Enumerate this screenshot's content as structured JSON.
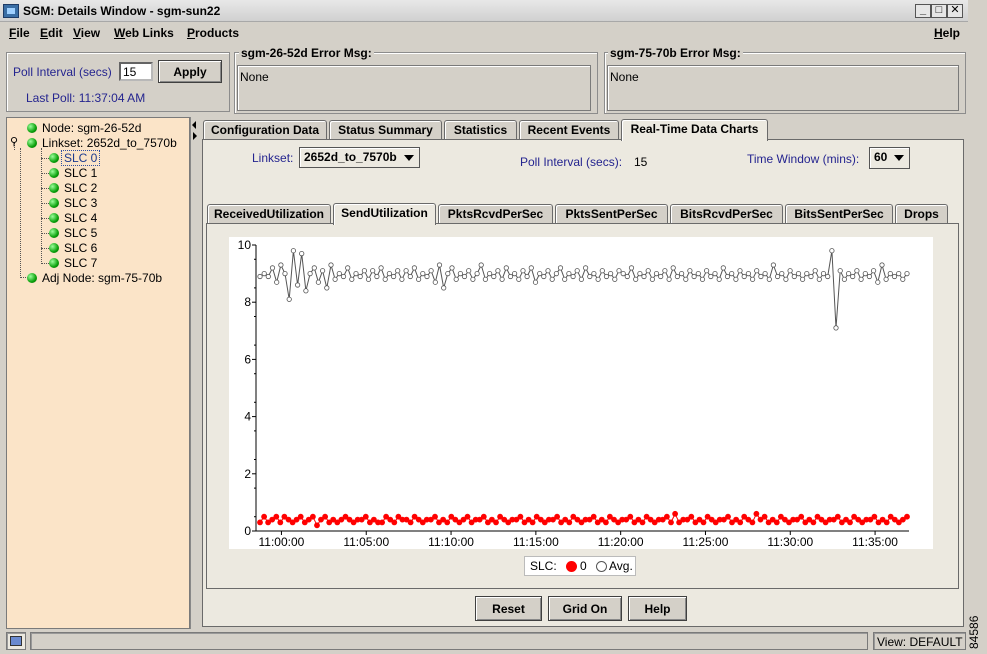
{
  "window": {
    "title": "SGM: Details Window - sgm-sun22",
    "figure_id": "84586"
  },
  "menu": {
    "items": [
      {
        "label": "File",
        "u": "F",
        "rest": "ile"
      },
      {
        "label": "Edit",
        "u": "E",
        "rest": "dit"
      },
      {
        "label": "View",
        "u": "V",
        "rest": "iew"
      },
      {
        "label": "Web Links",
        "u": "W",
        "rest": "eb Links"
      },
      {
        "label": "Products",
        "u": "P",
        "rest": "roducts"
      }
    ],
    "help": {
      "label": "Help",
      "u": "H",
      "rest": "elp"
    }
  },
  "poll": {
    "interval_label": "Poll Interval (secs)",
    "interval_value": "15",
    "apply_label": "Apply",
    "last_poll": "Last Poll:  11:37:04 AM"
  },
  "error_boxes": [
    {
      "title": "sgm-26-52d  Error Msg:",
      "message": "None"
    },
    {
      "title": "sgm-75-70b  Error Msg:",
      "message": "None"
    }
  ],
  "tree": {
    "node": "Node: sgm-26-52d",
    "linkset": "Linkset: 2652d_to_7570b",
    "slcs": [
      "SLC 0",
      "SLC 1",
      "SLC 2",
      "SLC 3",
      "SLC 4",
      "SLC 5",
      "SLC 6",
      "SLC 7"
    ],
    "selected_slc": "SLC 0",
    "adj_node": "Adj Node: sgm-75-70b"
  },
  "top_tabs": {
    "items": [
      "Configuration Data",
      "Status Summary",
      "Statistics",
      "Recent Events",
      "Real-Time Data Charts"
    ],
    "active": "Real-Time Data Charts"
  },
  "controls": {
    "linkset_label": "Linkset:",
    "linkset_value": "2652d_to_7570b",
    "poll_interval_label": "Poll Interval (secs):",
    "poll_interval_value": "15",
    "time_window_label": "Time Window (mins):",
    "time_window_value": "60"
  },
  "chart_tabs": {
    "items": [
      "ReceivedUtilization",
      "SendUtilization",
      "PktsRcvdPerSec",
      "PktsSentPerSec",
      "BitsRcvdPerSec",
      "BitsSentPerSec",
      "Drops"
    ],
    "active": "SendUtilization"
  },
  "chart": {
    "y_ticks": [
      "0",
      "2",
      "4",
      "6",
      "8",
      "10"
    ],
    "x_ticks": [
      "11:00:00",
      "11:05:00",
      "11:10:00",
      "11:15:00",
      "11:20:00",
      "11:25:00",
      "11:30:00",
      "11:35:00"
    ],
    "legend": {
      "prefix": "SLC:",
      "series0": "0",
      "avg": "Avg."
    },
    "colors": {
      "slc0": "#ff0000",
      "avg": "#555555"
    }
  },
  "chart_data": {
    "type": "line",
    "ylim": [
      0,
      10
    ],
    "x_range": [
      "10:58:30",
      "11:37:00"
    ],
    "x_ticks": [
      "11:00:00",
      "11:05:00",
      "11:10:00",
      "11:15:00",
      "11:20:00",
      "11:25:00",
      "11:30:00",
      "11:35:00"
    ],
    "series": [
      {
        "name": "0",
        "color": "#ff0000",
        "values": [
          0.3,
          0.5,
          0.3,
          0.4,
          0.5,
          0.3,
          0.5,
          0.4,
          0.3,
          0.4,
          0.5,
          0.3,
          0.4,
          0.5,
          0.2,
          0.4,
          0.5,
          0.3,
          0.4,
          0.3,
          0.4,
          0.5,
          0.4,
          0.3,
          0.4,
          0.4,
          0.5,
          0.3,
          0.4,
          0.3,
          0.3,
          0.5,
          0.4,
          0.3,
          0.5,
          0.4,
          0.4,
          0.3,
          0.5,
          0.4,
          0.3,
          0.4,
          0.4,
          0.5,
          0.3,
          0.4,
          0.3,
          0.5,
          0.4,
          0.3,
          0.4,
          0.5,
          0.3,
          0.4,
          0.4,
          0.5,
          0.3,
          0.4,
          0.3,
          0.5,
          0.4,
          0.3,
          0.4,
          0.4,
          0.5,
          0.3,
          0.4,
          0.3,
          0.5,
          0.4,
          0.3,
          0.4,
          0.4,
          0.5,
          0.3,
          0.4,
          0.3,
          0.5,
          0.4,
          0.3,
          0.4,
          0.4,
          0.5,
          0.3,
          0.4,
          0.3,
          0.5,
          0.4,
          0.3,
          0.4,
          0.4,
          0.5,
          0.3,
          0.4,
          0.3,
          0.5,
          0.4,
          0.3,
          0.4,
          0.4,
          0.5,
          0.3,
          0.6,
          0.3,
          0.4,
          0.4,
          0.5,
          0.3,
          0.4,
          0.3,
          0.5,
          0.4,
          0.3,
          0.4,
          0.4,
          0.5,
          0.3,
          0.4,
          0.3,
          0.5,
          0.4,
          0.3,
          0.6,
          0.4,
          0.5,
          0.3,
          0.4,
          0.3,
          0.5,
          0.4,
          0.3,
          0.4,
          0.4,
          0.5,
          0.3,
          0.4,
          0.3,
          0.5,
          0.4,
          0.3,
          0.4,
          0.4,
          0.5,
          0.3,
          0.4,
          0.3,
          0.5,
          0.4,
          0.3,
          0.4,
          0.4,
          0.5,
          0.3,
          0.4,
          0.3,
          0.5,
          0.4,
          0.3,
          0.4,
          0.5
        ]
      },
      {
        "name": "Avg.",
        "color": "#555555",
        "values": [
          8.9,
          9.0,
          8.9,
          9.2,
          8.7,
          9.3,
          9.0,
          8.1,
          9.8,
          8.6,
          9.7,
          8.4,
          9.0,
          9.2,
          8.7,
          9.1,
          8.5,
          9.3,
          8.8,
          9.0,
          8.9,
          9.2,
          8.8,
          9.0,
          8.9,
          9.1,
          8.8,
          9.1,
          8.9,
          9.2,
          8.8,
          9.0,
          8.9,
          9.1,
          8.8,
          9.1,
          8.9,
          9.2,
          8.8,
          9.0,
          8.9,
          9.1,
          8.7,
          9.3,
          8.5,
          9.0,
          9.2,
          8.8,
          9.0,
          8.9,
          9.1,
          8.8,
          9.0,
          9.3,
          8.8,
          9.0,
          8.9,
          9.1,
          8.8,
          9.2,
          8.9,
          9.0,
          8.8,
          9.1,
          8.9,
          9.2,
          8.7,
          9.0,
          8.9,
          9.1,
          8.8,
          9.0,
          9.2,
          8.8,
          9.0,
          8.9,
          9.1,
          8.8,
          9.2,
          8.9,
          9.0,
          8.8,
          9.1,
          8.9,
          9.0,
          8.8,
          9.1,
          9.0,
          8.9,
          9.2,
          8.8,
          9.0,
          8.9,
          9.1,
          8.8,
          9.0,
          8.9,
          9.1,
          8.8,
          9.2,
          8.9,
          9.0,
          8.8,
          9.1,
          8.9,
          9.0,
          8.8,
          9.1,
          8.9,
          9.0,
          8.8,
          9.2,
          8.9,
          9.0,
          8.8,
          9.1,
          8.9,
          9.0,
          8.8,
          9.1,
          8.9,
          9.0,
          8.8,
          9.3,
          8.9,
          9.0,
          8.8,
          9.1,
          8.9,
          9.0,
          8.8,
          9.0,
          8.9,
          9.1,
          8.8,
          9.0,
          8.9,
          9.8,
          7.1,
          9.1,
          8.8,
          9.0,
          8.9,
          9.1,
          8.8,
          9.0,
          8.9,
          9.1,
          8.7,
          9.3,
          8.8,
          9.0,
          8.9,
          9.0,
          8.8,
          9.0
        ]
      }
    ]
  },
  "buttons": {
    "reset": "Reset",
    "grid": "Grid On",
    "help": "Help"
  },
  "status": {
    "view": "View: DEFAULT"
  }
}
